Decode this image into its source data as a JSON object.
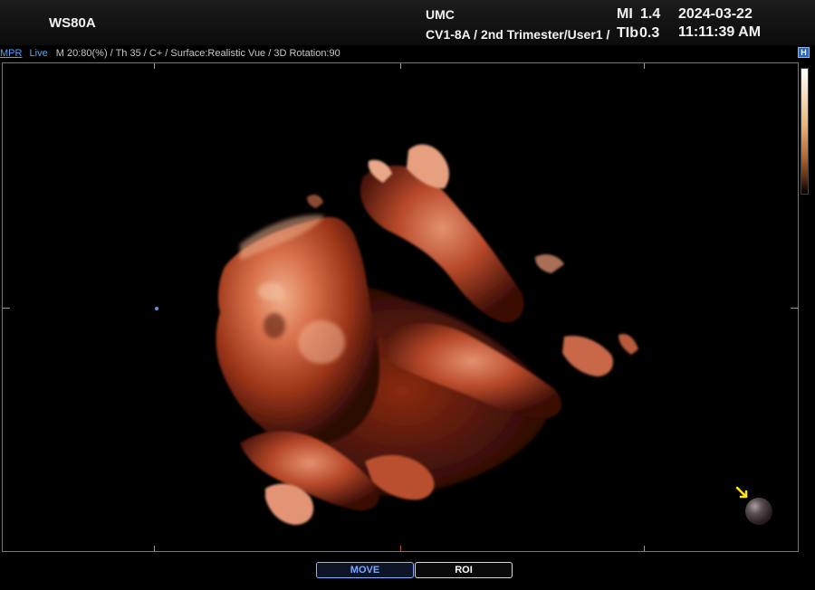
{
  "header": {
    "device": "WS80A",
    "hospital": "UMC",
    "probe_preset": "CV1-8A / 2nd Trimester/User1 /",
    "mi_label": "MI",
    "mi_value": "1.4",
    "tib_label": "TIb",
    "tib_value": "0.3",
    "date": "2024-03-22",
    "time": "11:11:39 AM"
  },
  "status": {
    "mode": "MPR",
    "live": "Live",
    "params": "M 20:80(%) / Th 35 / C+ / Surface:Realistic Vue / 3D Rotation:90"
  },
  "icons": {
    "h_button": "H"
  },
  "colors": {
    "accent_blue": "#4fa2ff",
    "render_tone": "#c8552e",
    "arrow_yellow": "#ffe21a"
  },
  "buttons": {
    "move": "MOVE",
    "roi": "ROI"
  }
}
